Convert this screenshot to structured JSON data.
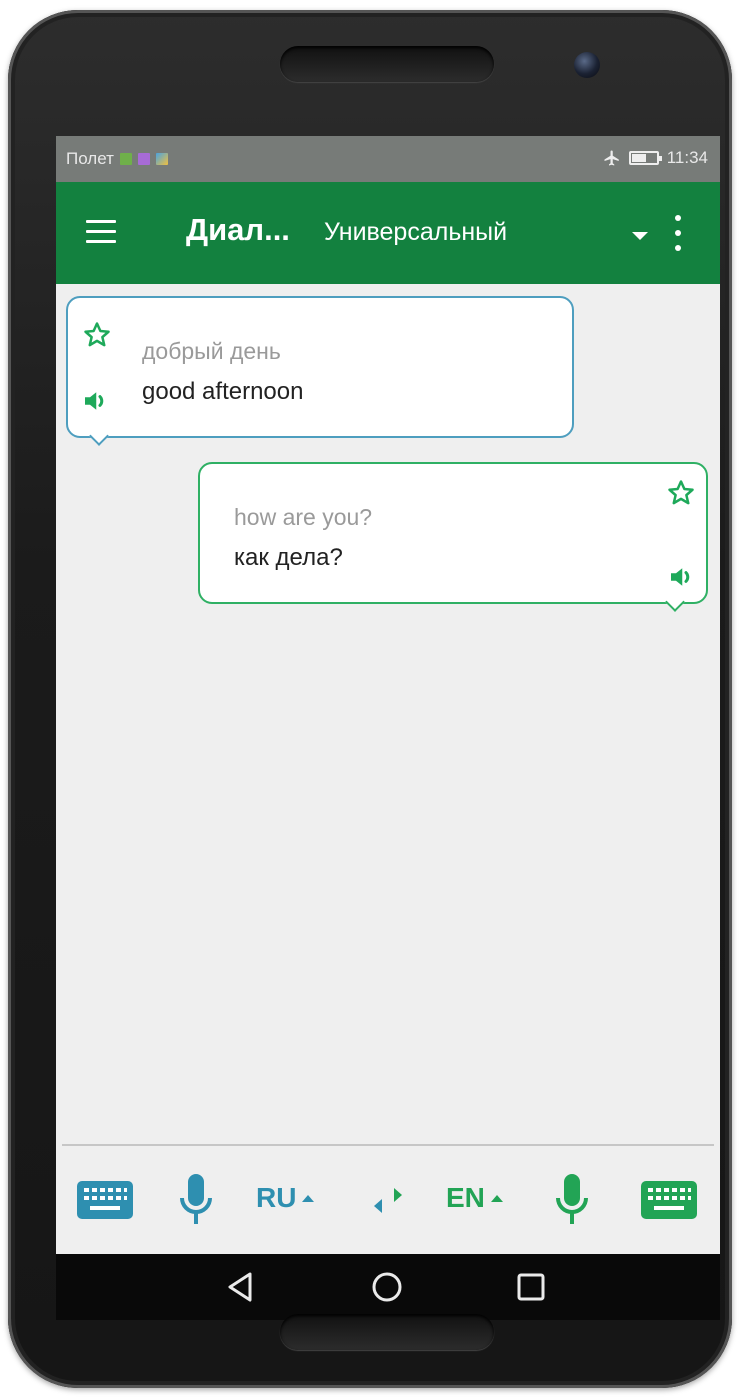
{
  "status_bar": {
    "carrier": "Полет",
    "time": "11:34",
    "icons": [
      "image-notification-icon",
      "app-notification-icon",
      "photo-notification-icon",
      "airplane-mode-icon",
      "battery-icon"
    ]
  },
  "app_bar": {
    "title": "Диал...",
    "mode": "Универсальный",
    "icons": [
      "menu-icon",
      "dropdown-arrow-icon",
      "overflow-menu-icon"
    ]
  },
  "messages": [
    {
      "side": "left",
      "source_text": "добрый день",
      "translation": "good afternoon",
      "accent": "#4e9ebf"
    },
    {
      "side": "right",
      "source_text": "how are you?",
      "translation": "как дела?",
      "accent": "#2fb064"
    }
  ],
  "bottom_bar": {
    "left_lang": "RU",
    "right_lang": "EN",
    "left_color": "#2e8fb0",
    "right_color": "#22a455",
    "icons": [
      "keyboard-icon",
      "microphone-icon",
      "swap-languages-icon",
      "microphone-icon",
      "keyboard-icon"
    ]
  },
  "nav_bar": {
    "icons": [
      "back-icon",
      "home-icon",
      "recent-apps-icon"
    ]
  },
  "colors": {
    "app_bar": "#13813f",
    "status_bar": "#777b78",
    "background": "#efefef",
    "star_green": "#1ea95a"
  }
}
